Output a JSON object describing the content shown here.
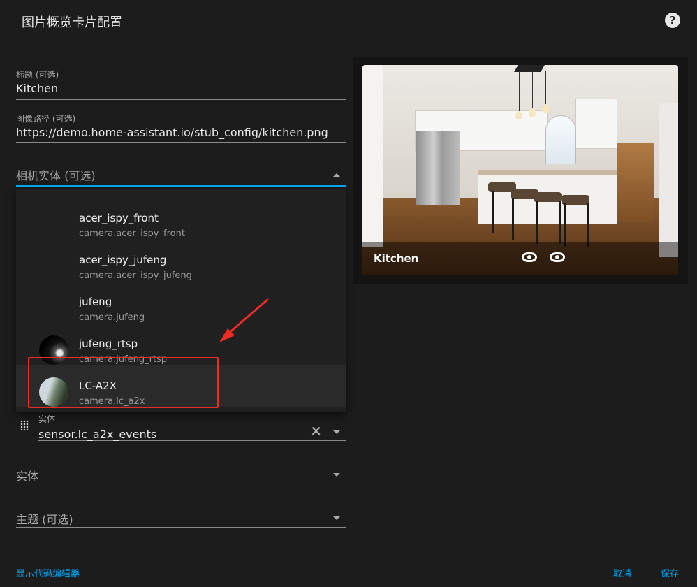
{
  "dialog": {
    "title": "图片概览卡片配置",
    "help_icon": "help-circle-icon"
  },
  "fields": {
    "title": {
      "label": "标题 (可选)",
      "value": "Kitchen"
    },
    "image_path": {
      "label": "图像路径 (可选)",
      "value": "https://demo.home-assistant.io/stub_config/kitchen.png"
    },
    "camera_entity": {
      "placeholder": "相机实体 (可选)"
    },
    "entity_row": {
      "label": "实体",
      "value": "sensor.lc_a2x_events",
      "clear_icon": "close-icon"
    },
    "entity": {
      "placeholder": "实体"
    },
    "theme": {
      "placeholder": "主题 (可选)"
    }
  },
  "dropdown": {
    "options": [
      {
        "name": "acer_ispy_front",
        "entity_id": "camera.acer_ispy_front"
      },
      {
        "name": "acer_ispy_jufeng",
        "entity_id": "camera.acer_ispy_jufeng"
      },
      {
        "name": "jufeng",
        "entity_id": "camera.jufeng"
      },
      {
        "name": "jufeng_rtsp",
        "entity_id": "camera.jufeng_rtsp"
      },
      {
        "name": "LC-A2X",
        "entity_id": "camera.lc_a2x"
      }
    ],
    "selected": "LC-A2X"
  },
  "preview": {
    "card_title": "Kitchen",
    "icons": [
      "eye-icon",
      "eye-icon"
    ]
  },
  "footer": {
    "show_code_editor": "显示代码编辑器",
    "cancel": "取消",
    "save": "保存"
  },
  "colors": {
    "accent": "#03a9f4",
    "highlight": "#ee2a24",
    "background": "#1c1c1c"
  }
}
